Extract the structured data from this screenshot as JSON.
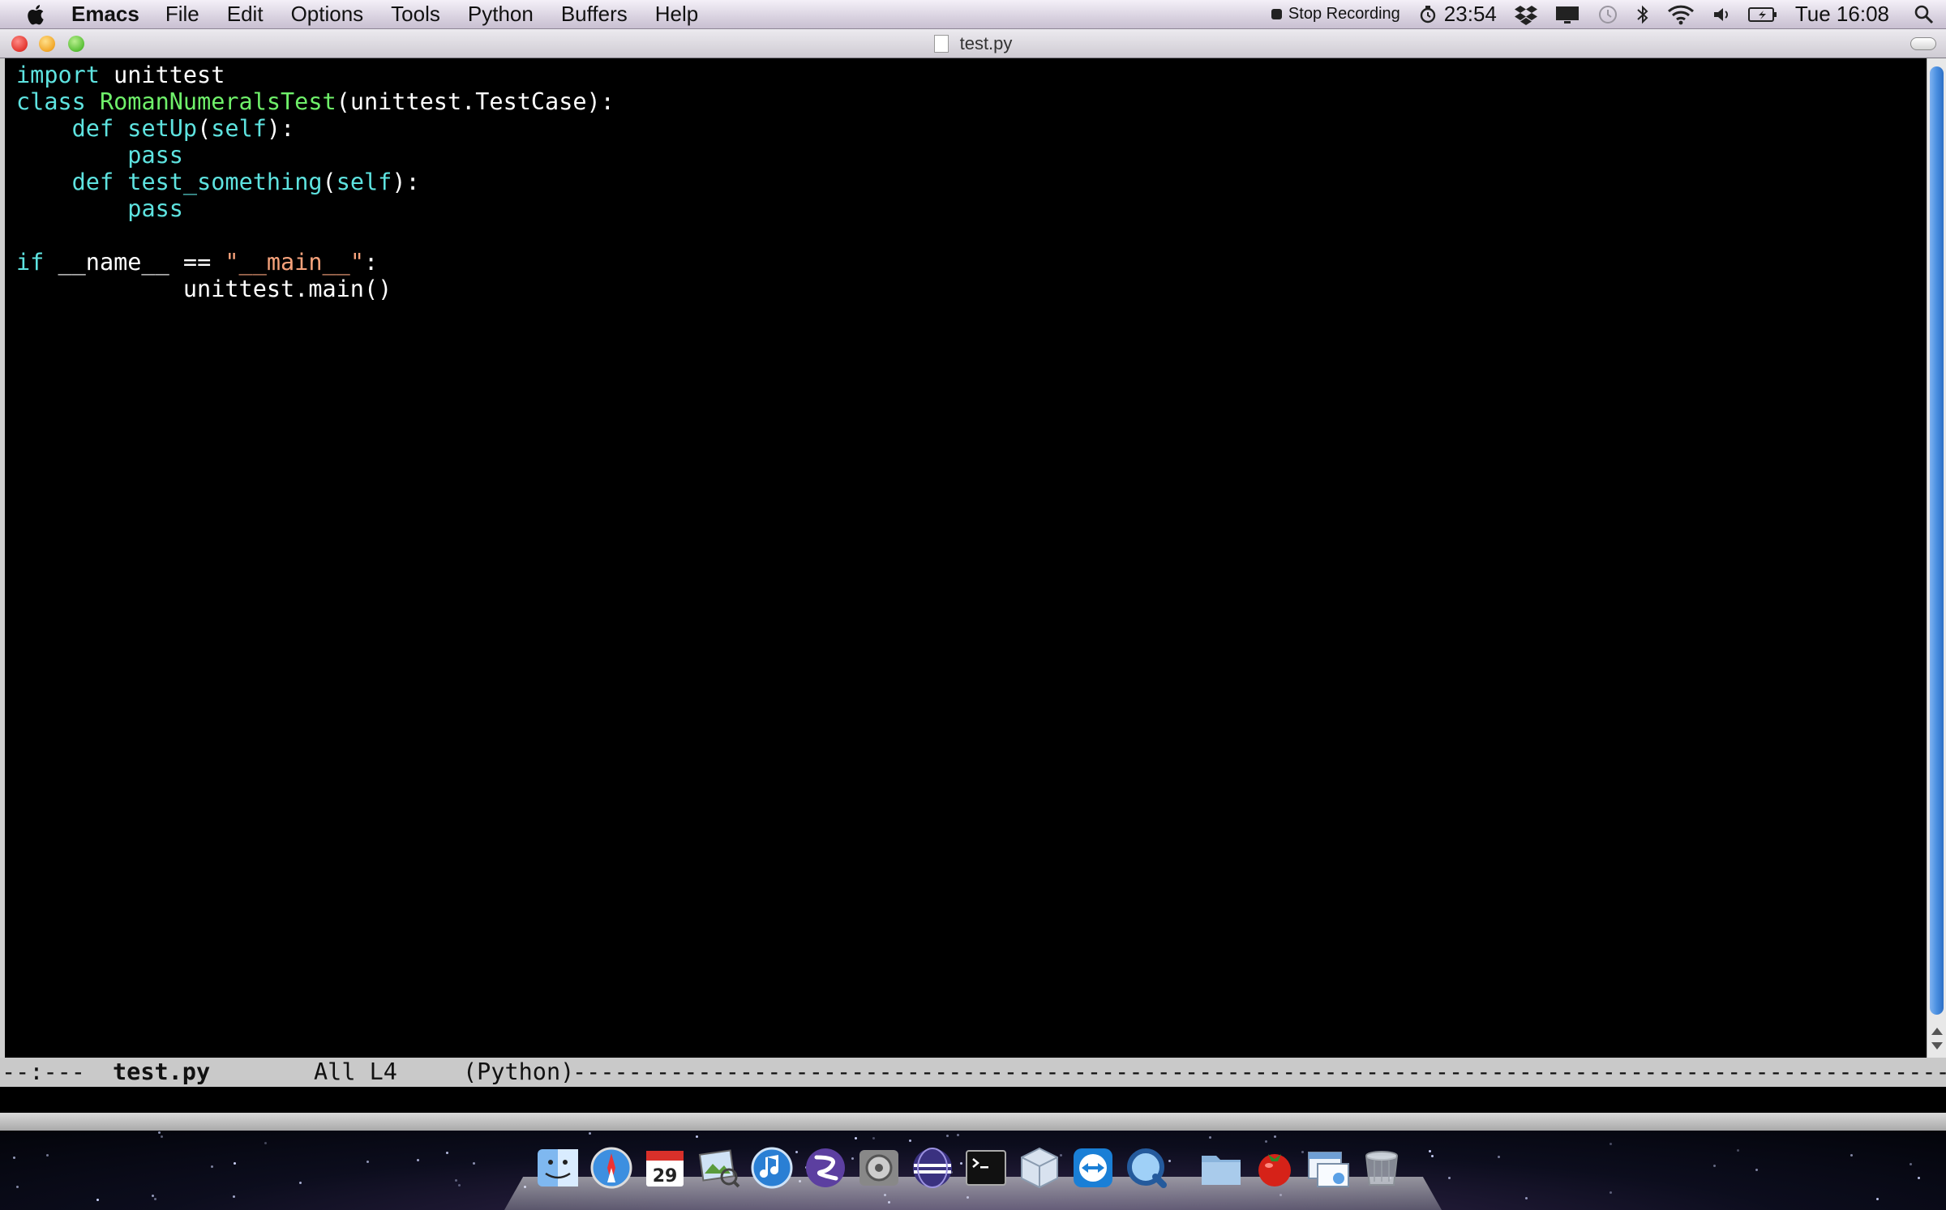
{
  "menubar": {
    "apple_icon": "apple-logo-icon",
    "items": [
      "Emacs",
      "File",
      "Edit",
      "Options",
      "Tools",
      "Python",
      "Buffers",
      "Help"
    ],
    "stop_recording": "Stop Recording",
    "timer": "23:54",
    "clock": "Tue 16:08",
    "status_icons": [
      "timer-icon",
      "dropbox-icon",
      "display-icon",
      "time-machine-icon",
      "bluetooth-icon",
      "wifi-icon",
      "volume-icon",
      "battery-icon",
      "spotlight-icon"
    ]
  },
  "window": {
    "title": "test.py"
  },
  "editor": {
    "lines": [
      [
        {
          "t": "import",
          "c": "kw"
        },
        {
          "t": " unittest",
          "c": "plain"
        }
      ],
      [
        {
          "t": "class",
          "c": "kw"
        },
        {
          "t": " ",
          "c": "plain"
        },
        {
          "t": "RomanNumeralsTest",
          "c": "fn"
        },
        {
          "t": "(unittest.TestCase):",
          "c": "plain"
        }
      ],
      [
        {
          "t": "    ",
          "c": "plain"
        },
        {
          "t": "def",
          "c": "kw"
        },
        {
          "t": " ",
          "c": "plain"
        },
        {
          "t": "setUp",
          "c": "kw"
        },
        {
          "t": "(",
          "c": "plain"
        },
        {
          "t": "self",
          "c": "kw"
        },
        {
          "t": "):",
          "c": "plain"
        }
      ],
      [
        {
          "t": "        ",
          "c": "plain"
        },
        {
          "t": "pass",
          "c": "kw"
        }
      ],
      [
        {
          "t": "    ",
          "c": "plain"
        },
        {
          "t": "def",
          "c": "kw"
        },
        {
          "t": " ",
          "c": "plain"
        },
        {
          "t": "test_something",
          "c": "kw"
        },
        {
          "t": "(",
          "c": "plain"
        },
        {
          "t": "self",
          "c": "kw"
        },
        {
          "t": "):",
          "c": "plain"
        }
      ],
      [
        {
          "t": "        ",
          "c": "plain"
        },
        {
          "t": "pass",
          "c": "kw"
        }
      ],
      [
        {
          "t": "",
          "c": "plain"
        }
      ],
      [
        {
          "t": "if",
          "c": "kw"
        },
        {
          "t": " __name__ == ",
          "c": "plain"
        },
        {
          "t": "\"__main__\"",
          "c": "str"
        },
        {
          "t": ":",
          "c": "plain"
        }
      ],
      [
        {
          "t": "            unittest.main()",
          "c": "plain"
        }
      ]
    ]
  },
  "modeline": {
    "status": "--:---",
    "buffer": "test.py",
    "position": "All L4",
    "mode": "(Python)"
  },
  "dock": {
    "items": [
      "finder-icon",
      "safari-icon",
      "ical-icon",
      "preview-icon",
      "itunes-icon",
      "emacs-icon",
      "system-preferences-icon",
      "eclipse-icon",
      "terminal-icon",
      "virtualbox-icon",
      "teamviewer-icon",
      "quicktime-icon",
      "folder-icon",
      "tomato-timer-icon",
      "downloads-icon",
      "trash-icon"
    ],
    "ical_day": "29"
  },
  "colors": {
    "keyword": "#5ee3e0",
    "function_name": "#6ff06a",
    "string": "#f6a27b",
    "default_text": "#ffffff",
    "background": "#000000"
  }
}
